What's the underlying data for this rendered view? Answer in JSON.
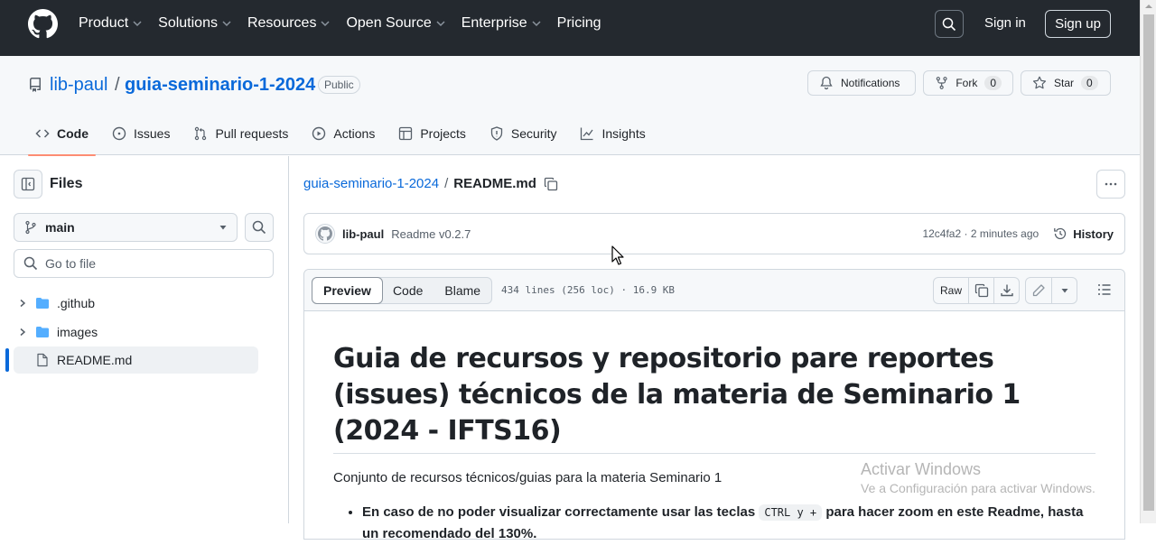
{
  "nav": {
    "items": [
      "Product",
      "Solutions",
      "Resources",
      "Open Source",
      "Enterprise",
      "Pricing"
    ],
    "signin": "Sign in",
    "signup": "Sign up"
  },
  "repo": {
    "owner": "lib-paul",
    "name": "guia-seminario-1-2024",
    "visibility": "Public",
    "notifications": "Notifications",
    "fork_label": "Fork",
    "fork_count": "0",
    "star_label": "Star",
    "star_count": "0"
  },
  "tabs": [
    "Code",
    "Issues",
    "Pull requests",
    "Actions",
    "Projects",
    "Security",
    "Insights"
  ],
  "sidebar": {
    "title": "Files",
    "branch": "main",
    "goto_placeholder": "Go to file",
    "tree": [
      {
        "name": ".github",
        "type": "folder"
      },
      {
        "name": "images",
        "type": "folder"
      },
      {
        "name": "README.md",
        "type": "file"
      }
    ]
  },
  "breadcrumb": {
    "repo": "guia-seminario-1-2024",
    "sep": "/",
    "file": "README.md"
  },
  "commit": {
    "author": "lib-paul",
    "message": "Readme v0.2.7",
    "meta": "12c4fa2 · 2 minutes ago",
    "history": "History"
  },
  "filebar": {
    "views": [
      "Preview",
      "Code",
      "Blame"
    ],
    "info": "434 lines (256 loc) · 16.9 KB",
    "raw": "Raw"
  },
  "readme": {
    "heading": "Guia de recursos y repositorio pare reportes (issues) técnicos de la materia de Seminario 1 (2024 - IFTS16)",
    "intro": "Conjunto de recursos técnicos/guias para la materia Seminario 1",
    "bullet_pre": "En caso de no poder visualizar correctamente usar las teclas",
    "bullet_code": "CTRL y +",
    "bullet_post": "para hacer zoom en este Readme, hasta un recomendado del 130%."
  },
  "watermark": {
    "line1": "Activar Windows",
    "line2": "Ve a Configuración para activar Windows."
  }
}
